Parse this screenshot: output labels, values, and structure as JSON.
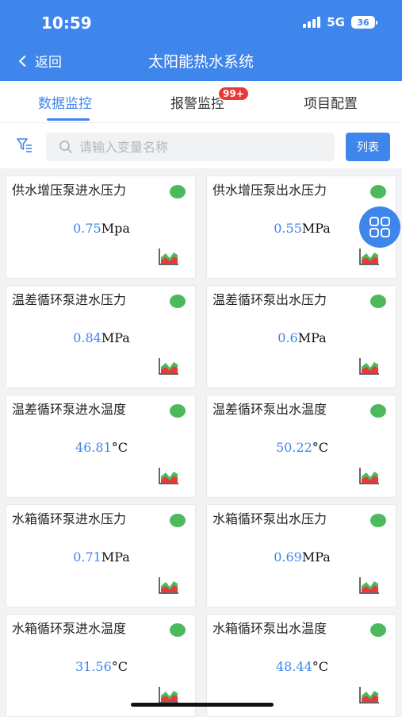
{
  "status": {
    "time": "10:59",
    "network": "5G",
    "battery": "36"
  },
  "header": {
    "back_label": "返回",
    "title": "太阳能热水系统"
  },
  "tabs": [
    {
      "label": "数据监控",
      "active": true
    },
    {
      "label": "报警监控",
      "badge": "99+"
    },
    {
      "label": "项目配置"
    }
  ],
  "search": {
    "placeholder": "请输入变量名称",
    "value": "",
    "list_button": "列表"
  },
  "cards": [
    {
      "name": "供水增压泵进水压力",
      "value": "0.75",
      "unit": "Mpa",
      "status": "green"
    },
    {
      "name": "供水增压泵出水压力",
      "value": "0.55",
      "unit": "MPa",
      "status": "green"
    },
    {
      "name": "温差循环泵进水压力",
      "value": "0.84",
      "unit": "MPa",
      "status": "green"
    },
    {
      "name": "温差循环泵出水压力",
      "value": "0.6",
      "unit": "MPa",
      "status": "green"
    },
    {
      "name": "温差循环泵进水温度",
      "value": "46.81",
      "unit": "°C",
      "status": "green"
    },
    {
      "name": "温差循环泵出水温度",
      "value": "50.22",
      "unit": "°C",
      "status": "green"
    },
    {
      "name": "水箱循环泵进水压力",
      "value": "0.71",
      "unit": "MPa",
      "status": "green"
    },
    {
      "name": "水箱循环泵出水压力",
      "value": "0.69",
      "unit": "MPa",
      "status": "green"
    },
    {
      "name": "水箱循环泵进水温度",
      "value": "31.56",
      "unit": "°C",
      "status": "green"
    },
    {
      "name": "水箱循环泵出水温度",
      "value": "48.44",
      "unit": "°C",
      "status": "green"
    }
  ],
  "colors": {
    "accent": "#3f86ec",
    "status_green": "#4cba5c",
    "badge_red": "#e8393b"
  },
  "icons": {
    "card_chart": "area-chart-icon",
    "fab": "grid-menu-icon",
    "filter": "filter-icon",
    "search": "search-icon"
  }
}
